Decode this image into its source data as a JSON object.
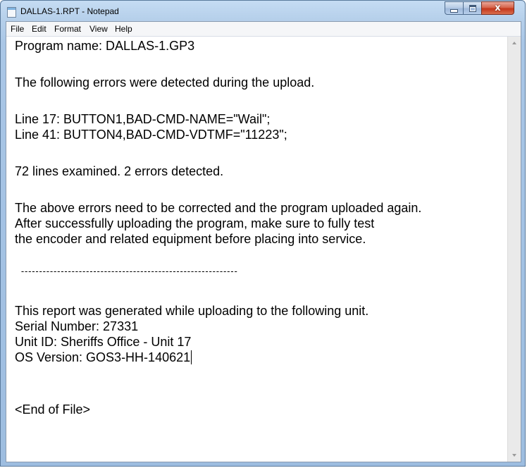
{
  "window": {
    "title": "DALLAS-1.RPT - Notepad",
    "close_glyph": "x"
  },
  "menu": {
    "file": "File",
    "edit": "Edit",
    "format": "Format",
    "view": "View",
    "help": "Help"
  },
  "document": {
    "lines": [
      "Program name: DALLAS-1.GP3",
      "",
      "The following errors were detected during the upload.",
      "",
      "Line 17: BUTTON1,BAD-CMD-NAME=\"Wail\";",
      "Line 41: BUTTON4,BAD-CMD-VDTMF=\"11223\";",
      "",
      "72 lines examined. 2 errors detected.",
      "",
      "The above errors need to be corrected and the program uploaded again.",
      "After successfully uploading the program, make sure to fully test",
      "the encoder and related equipment before placing into service.",
      "",
      "  ------------------------------------------------------------",
      "",
      "This report was generated while uploading to the following unit.",
      "Serial Number: 27331",
      "Unit ID: Sheriffs Office - Unit 17",
      "OS Version: GOS3-HH-140621",
      "",
      "",
      "<End of File>"
    ]
  },
  "icons": {
    "app": "notepad-icon",
    "minimize": "minimize-icon",
    "maximize": "maximize-icon",
    "close": "close-icon",
    "scroll_up": "scroll-up-arrow-icon",
    "scroll_down": "scroll-down-arrow-icon"
  },
  "colors": {
    "titlebar": "#b5cfea",
    "close_button": "#c4361b",
    "text": "#000000",
    "editor_background": "#ffffff"
  }
}
